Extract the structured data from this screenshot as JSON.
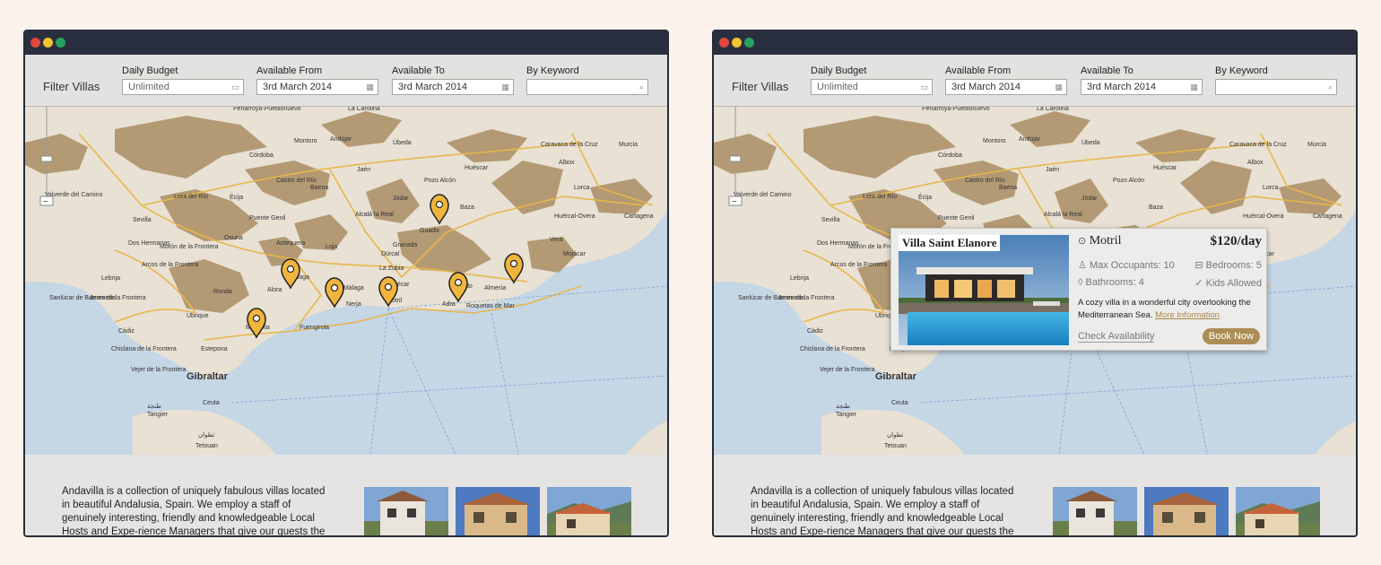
{
  "filter": {
    "title": "Filter Villas",
    "budget_label": "Daily Budget",
    "budget_value": "Unlimited",
    "from_label": "Available From",
    "from_value": "3rd March 2014",
    "to_label": "Available To",
    "to_value": "3rd March 2014",
    "keyword_label": "By Keyword",
    "keyword_value": ""
  },
  "map": {
    "cities": [
      "Peñarroya-Pueblonuevo",
      "La Carolina",
      "Montoro",
      "Andújar",
      "Úbeda",
      "Córdoba",
      "Jaén",
      "Huéscar",
      "Pozo Alcón",
      "Murcia",
      "Valverde del Camino",
      "Lora del Río",
      "Écija",
      "Castro del Río",
      "Baena",
      "Jódar",
      "Caravaca de la Cruz",
      "Lorca",
      "Cartagena",
      "Sevilla",
      "Dos Hermanas",
      "Puente Genil",
      "Alcalá la Real",
      "Guadix",
      "Baza",
      "Huércal-Overa",
      "Granada",
      "Loja",
      "Antequera",
      "Málaga",
      "Marbella",
      "Fuengirola",
      "Nerja",
      "Motril",
      "Adra",
      "Almería",
      "Roquetas de Mar",
      "El Ejido",
      "Cádiz",
      "Jerez de la Frontera",
      "Sanlúcar de Barrameda",
      "Estepona",
      "Gibraltar",
      "Tangier",
      "Ceuta",
      "Tetouan",
      "Chiclana de la Frontera",
      "Vejer de la Frontera",
      "Arcos de la Frontera",
      "Ubrique",
      "Ronda",
      "Lebrija",
      "Morón de la Frontera",
      "Osuna",
      "Alora",
      "Vélez-Málaga",
      "Almuñécar",
      "Albox",
      "Vera",
      "Mojácar",
      "La Zubia",
      "Dúrcal",
      "طنجة",
      "تطوان"
    ],
    "zoom_plus": "+",
    "zoom_minus": "−"
  },
  "lower": {
    "description": "Andavilla is a collection of uniquely fabulous villas located in beautiful Andalusia, Spain. We employ a staff of genuinely interesting, friendly and knowledgeable Local Hosts and Expe-rience Managers that give our guests the authentic, yet luxuri-"
  },
  "popup": {
    "villa_name": "Villa Saint Elanore",
    "location": "Motril",
    "price": "$120/day",
    "max_occupants": "Max Occupants: 10",
    "bedrooms": "Bedrooms: 5",
    "bathrooms": "Bathrooms: 4",
    "kids": "Kids Allowed",
    "blurb": "A cozy villa in a wonderful city overlooking the Mediterranean Sea.",
    "more_link": "More Information",
    "check_label": "Check Availability",
    "book_label": "Book Now"
  },
  "icons": [
    "calendar-icon",
    "search-icon",
    "map-pin-icon",
    "location-pin-icon",
    "person-icon",
    "bed-icon",
    "droplet-icon",
    "check-icon"
  ],
  "colors": {
    "pin": "#f0b53c",
    "mountain": "#b39a74",
    "land": "#e8e1d4",
    "sea": "#c5d6e5",
    "book_button": "#ad8d55",
    "titlebar": "#2a2f3f"
  }
}
